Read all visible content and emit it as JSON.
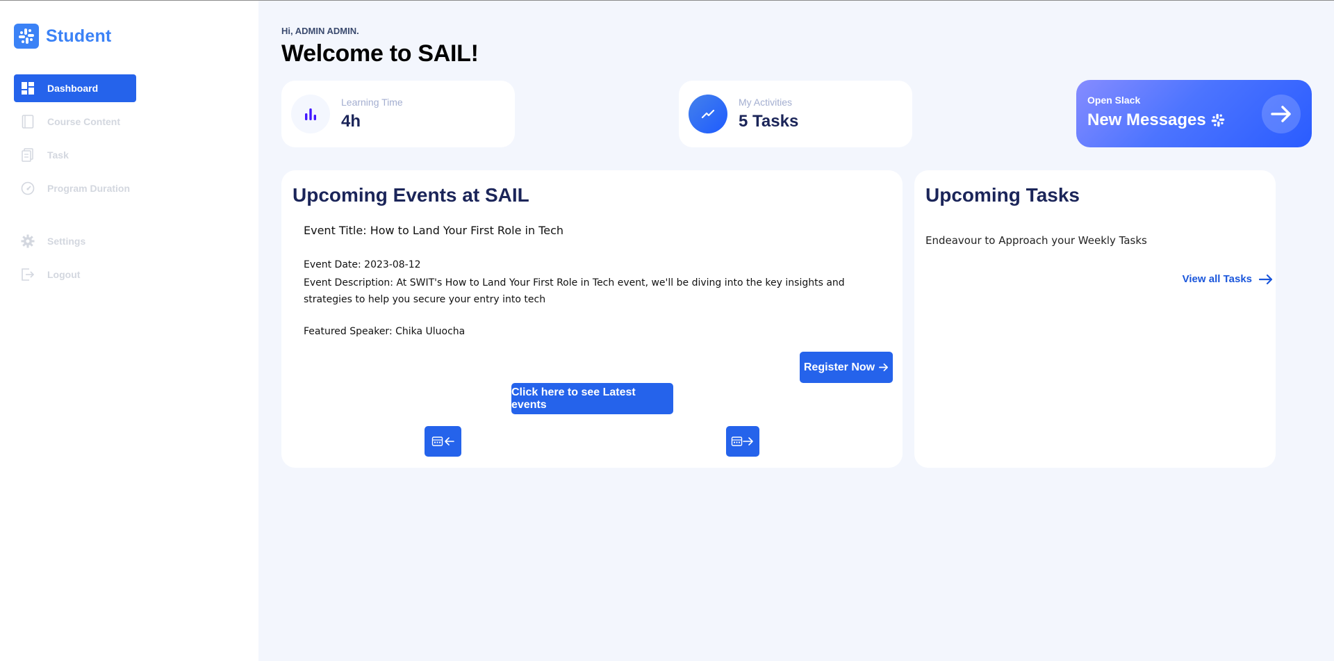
{
  "app": {
    "brand": "Student"
  },
  "sidebar": {
    "items": [
      {
        "label": "Dashboard",
        "icon": "dashboard-icon",
        "active": true
      },
      {
        "label": "Course Content",
        "icon": "book-icon",
        "active": false
      },
      {
        "label": "Task",
        "icon": "task-icon",
        "active": false
      },
      {
        "label": "Program Duration",
        "icon": "gauge-icon",
        "active": false
      }
    ],
    "bottom_items": [
      {
        "label": "Settings",
        "icon": "gear-icon"
      },
      {
        "label": "Logout",
        "icon": "logout-icon"
      }
    ]
  },
  "header": {
    "greeting": "Hi, ADMIN ADMIN.",
    "title": "Welcome to SAIL!"
  },
  "stats": {
    "learning": {
      "label": "Learning Time",
      "value": "4h",
      "icon": "bar-chart-icon"
    },
    "activities": {
      "label": "My Activities",
      "value": "5 Tasks",
      "icon": "trend-icon"
    },
    "slack": {
      "label": "Open Slack",
      "value": "New Messages",
      "icon": "slack-icon"
    }
  },
  "events": {
    "heading": "Upcoming Events at SAIL",
    "title": "Event Title: How to Land Your First Role in Tech",
    "date": "Event Date: 2023-08-12",
    "description": "Event Description: At SWIT's How to Land Your First Role in Tech event, we'll be diving into the key insights and strategies to help you secure your entry into tech",
    "speaker": "Featured Speaker: Chika Uluocha",
    "register_label": "Register Now",
    "latest_label": "Click here to see Latest events"
  },
  "tasks": {
    "heading": "Upcoming Tasks",
    "subtitle": "Endeavour to Approach your Weekly Tasks",
    "view_all_label": "View all Tasks"
  },
  "colors": {
    "primary": "#2563eb",
    "brand": "#3b82f6",
    "background": "#f3f6fd",
    "navy": "#1b2559",
    "muted": "#a3aed0"
  }
}
